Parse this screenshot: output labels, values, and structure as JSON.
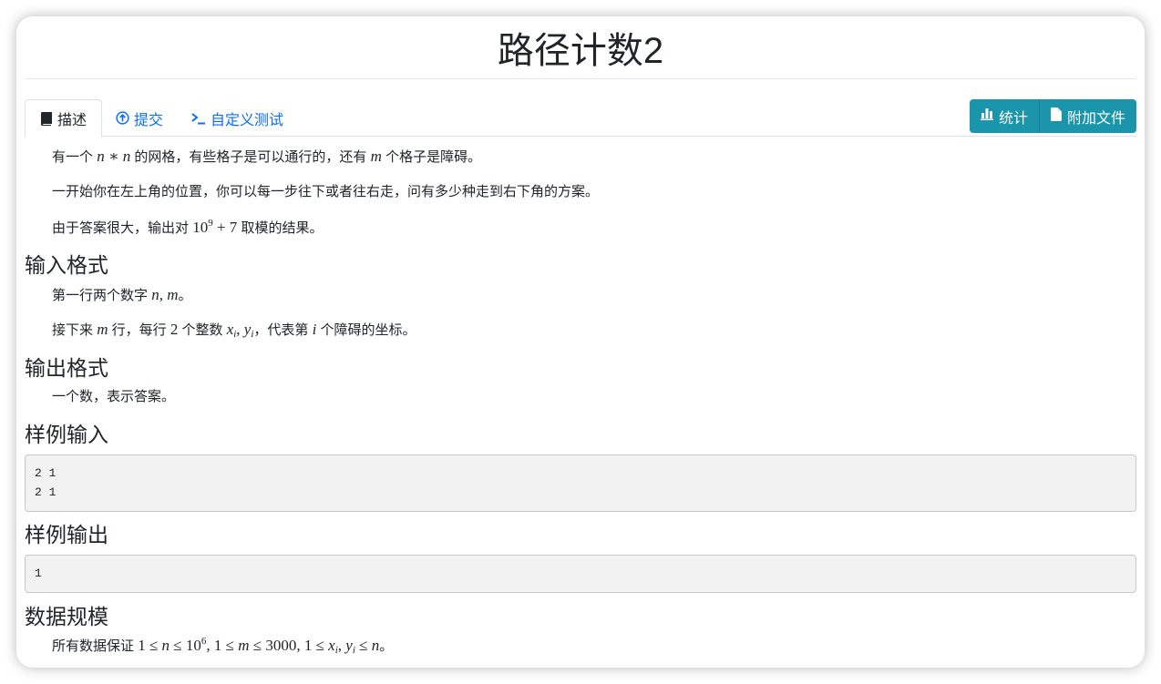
{
  "problem": {
    "title": "路径计数2"
  },
  "tabs": [
    {
      "label": "描述",
      "icon": "book-icon",
      "active": true
    },
    {
      "label": "提交",
      "icon": "arrow-circle-up-icon",
      "active": false
    },
    {
      "label": "自定义测试",
      "icon": "terminal-prompt-icon",
      "active": false
    }
  ],
  "actions": {
    "stats_label": "统计",
    "stats_icon": "bar-chart-icon",
    "attachments_label": "附加文件",
    "attachments_icon": "file-icon"
  },
  "colors": {
    "accent": "#1b95ab",
    "link": "#0d6efd"
  },
  "description": {
    "p1": {
      "pre": "有一个",
      "math": "n ∗ n",
      "post": "的网格，有些格子是可以通行的，还有",
      "math2": "m",
      "post2": "个格子是障碍。"
    },
    "p2": "一开始你在左上角的位置，你可以每一步往下或者往右走，问有多少种走到右下角的方案。",
    "p3": {
      "pre": "由于答案很大，输出对",
      "base": "10",
      "exp": "9",
      "tail": " + 7",
      "post": "取模的结果。"
    }
  },
  "input_format": {
    "heading": "输入格式",
    "line1": {
      "pre": "第一行两个数字",
      "math": "n, m",
      "post": "。"
    },
    "line2": {
      "pre": "接下来",
      "m": "m",
      "mid1": "行，每行",
      "two": "2",
      "mid2": "个整数",
      "x": "x",
      "i1": "i",
      "comma": ", ",
      "y": "y",
      "i2": "i",
      "mid3": "，代表第",
      "i3": "i",
      "post": "个障碍的坐标。"
    }
  },
  "output_format": {
    "heading": "输出格式",
    "text": "一个数，表示答案。"
  },
  "sample_input": {
    "heading": "样例输入",
    "content": "2 1\n2 1"
  },
  "sample_output": {
    "heading": "样例输出",
    "content": "1"
  },
  "constraints": {
    "heading": "数据规模",
    "pre": "所有数据保证",
    "a": "1 ≤ ",
    "n": "n",
    "b": " ≤ 10",
    "exp": "6",
    "c": ", 1 ≤ ",
    "m": "m",
    "d": " ≤ 3000, 1 ≤ ",
    "x": "x",
    "i1": "i",
    "e": ", ",
    "y": "y",
    "i2": "i",
    "f": " ≤ ",
    "n2": "n",
    "post": "。"
  }
}
